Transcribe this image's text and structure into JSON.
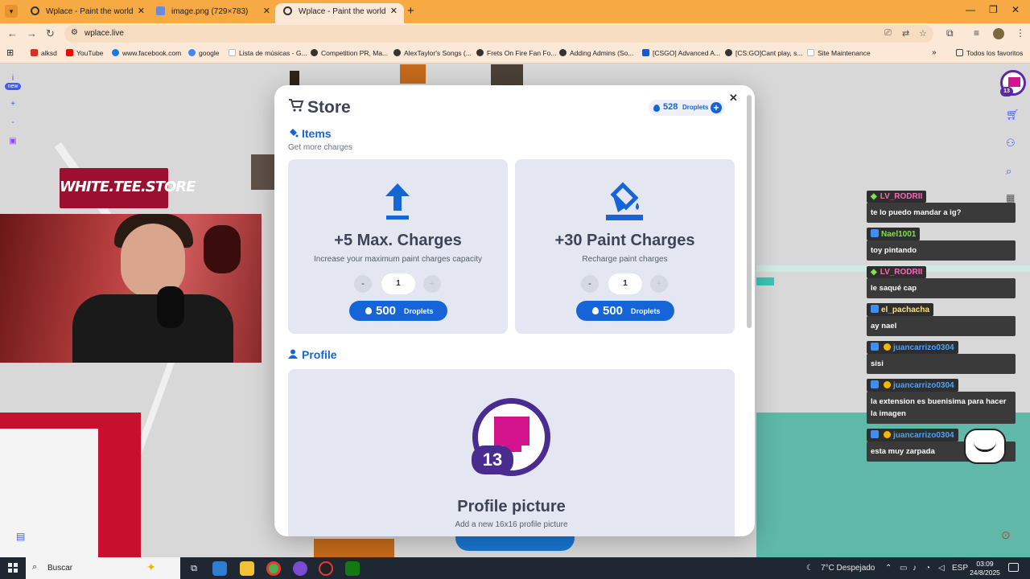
{
  "browser": {
    "tabs": [
      {
        "title": "Wplace - Paint the world"
      },
      {
        "title": "image.png (729×783)"
      },
      {
        "title": "Wplace - Paint the world"
      }
    ],
    "url": "wplace.live",
    "bookmarks": [
      {
        "label": "alksd",
        "color": "#d93025"
      },
      {
        "label": "YouTube",
        "color": "#ff0000"
      },
      {
        "label": "www.facebook.com",
        "color": "#1877f2"
      },
      {
        "label": "google",
        "color": "#4285f4"
      },
      {
        "label": "Lista de músicas - G...",
        "color": "#ffffff"
      },
      {
        "label": "Competition PR, Ma...",
        "color": "#333333"
      },
      {
        "label": "AlexTaylor's Songs (...",
        "color": "#333333"
      },
      {
        "label": "Frets On Fire Fan Fo...",
        "color": "#333333"
      },
      {
        "label": "Adding Admins (So...",
        "color": "#333333"
      },
      {
        "label": "[CSGO] Advanced A...",
        "color": "#1a57c8"
      },
      {
        "label": "[CS:GO]Cant play, s...",
        "color": "#333333"
      },
      {
        "label": "Site Maintenance",
        "color": "#ffffff"
      }
    ],
    "all_favorites": "Todos los favoritos"
  },
  "overlay": {
    "left_badge": "new",
    "store_banner": "WHITE.TEE.STORE",
    "right_level": "13"
  },
  "chat": [
    {
      "user": "LV_RODRII",
      "user_color": "#f56cb8",
      "badge": "gem",
      "text": "te lo puedo mandar a ig?"
    },
    {
      "user": "Nael1001",
      "user_color": "#7de34a",
      "badge": "box",
      "text": "toy pintando"
    },
    {
      "user": "LV_RODRII",
      "user_color": "#f56cb8",
      "badge": "gem",
      "text": "le saqué cap"
    },
    {
      "user": "el_pachacha",
      "user_color": "#ffe36b",
      "badge": "box",
      "text": "ay nael"
    },
    {
      "user": "juancarrizo0304",
      "user_color": "#4aa3ff",
      "badge": "box-coin",
      "text": "sisi"
    },
    {
      "user": "juancarrizo0304",
      "user_color": "#4aa3ff",
      "badge": "box-coin",
      "text": "la extension es buenisima para hacer la imagen"
    },
    {
      "user": "juancarrizo0304",
      "user_color": "#4aa3ff",
      "badge": "box-coin",
      "text": "esta muy zarpada"
    }
  ],
  "store": {
    "title": "Store",
    "droplets": "528",
    "droplets_unit": "Droplets",
    "items_heading": "Items",
    "items_sub": "Get more charges",
    "items": [
      {
        "icon": "upload-arrow-icon",
        "title": "+5 Max. Charges",
        "desc": "Increase your maximum paint charges capacity",
        "minus": "-",
        "qty": "1",
        "plus": "+",
        "price": "500",
        "price_unit": "Droplets"
      },
      {
        "icon": "paint-bucket-icon",
        "title": "+30 Paint Charges",
        "desc": "Recharge paint charges",
        "minus": "-",
        "qty": "1",
        "plus": "+",
        "price": "500",
        "price_unit": "Droplets"
      }
    ],
    "profile_heading": "Profile",
    "profile": {
      "level": "13",
      "title": "Profile picture",
      "desc": "Add a new 16x16 profile picture"
    }
  },
  "taskbar": {
    "search": "Buscar",
    "weather": "7°C  Despejado",
    "lang": "ESP",
    "time": "03:09",
    "date": "24/8/2025"
  },
  "colors": {
    "accent": "#1565d8",
    "tab_bar": "#f7a943",
    "profile_ring": "#4a2b8f",
    "profile_pink": "#d4148f"
  }
}
